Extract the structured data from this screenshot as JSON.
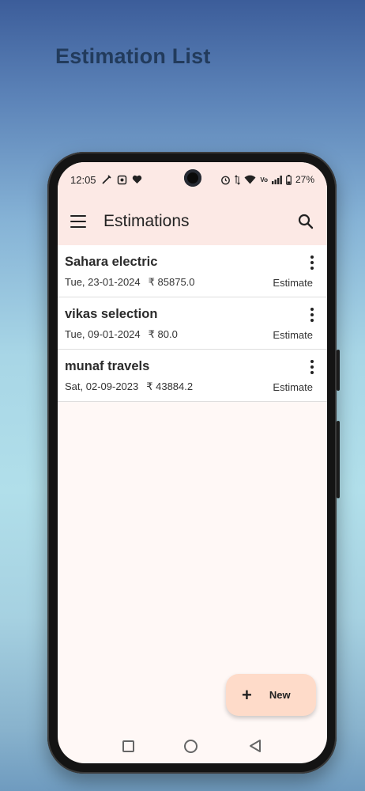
{
  "headline": "Estimation List",
  "status_bar": {
    "time": "12:05",
    "left_icons": [
      "pen-icon",
      "capture-icon",
      "heart-icon"
    ],
    "right_icons": [
      "alarm-icon",
      "data-arrows-icon",
      "wifi-icon",
      "volte-icon",
      "signal-icon",
      "battery-icon"
    ],
    "battery": "27%",
    "volte_label": "Vo"
  },
  "appbar": {
    "title": "Estimations",
    "menu_icon": "menu-icon",
    "search_icon": "search-icon"
  },
  "estimations": [
    {
      "name": "Sahara electric",
      "date": "Tue, 23-01-2024",
      "amount": "₹ 85875.0",
      "type": "Estimate"
    },
    {
      "name": "vikas selection",
      "date": "Tue, 09-01-2024",
      "amount": "₹ 80.0",
      "type": "Estimate"
    },
    {
      "name": "munaf travels",
      "date": "Sat, 02-09-2023",
      "amount": "₹ 43884.2",
      "type": "Estimate"
    }
  ],
  "fab": {
    "icon": "plus",
    "label": "New"
  },
  "colors": {
    "appbar_bg": "#fce9e5",
    "screen_bg": "#fff8f6",
    "fab_bg": "#fedbc9",
    "headline": "#223b5c"
  }
}
